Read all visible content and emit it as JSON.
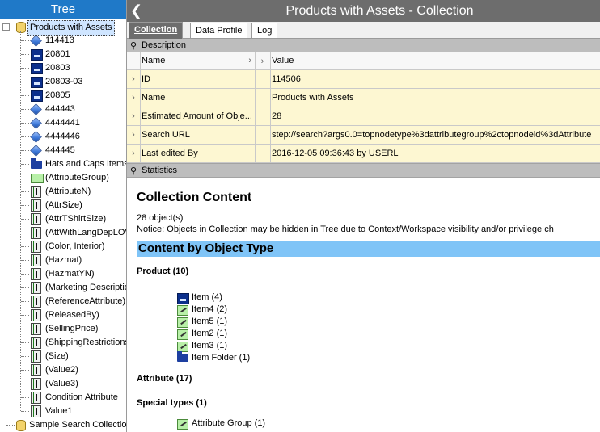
{
  "tree": {
    "header": "Tree",
    "root_label": "Products with Assets",
    "items": [
      {
        "label": "114413",
        "icon": "cube-icon"
      },
      {
        "label": "20801",
        "icon": "item-icon"
      },
      {
        "label": "20803",
        "icon": "item-icon"
      },
      {
        "label": "20803-03",
        "icon": "item-icon"
      },
      {
        "label": "20805",
        "icon": "item-icon"
      },
      {
        "label": "444443",
        "icon": "cube-icon"
      },
      {
        "label": "4444441",
        "icon": "cube-icon"
      },
      {
        "label": "4444446",
        "icon": "cube-icon"
      },
      {
        "label": "444445",
        "icon": "cube-icon"
      },
      {
        "label": "Hats and Caps Items",
        "icon": "folder-icon"
      },
      {
        "label": "(AttributeGroup)",
        "icon": "attribute-group-icon"
      },
      {
        "label": "(AttributeN)",
        "icon": "attribute-icon"
      },
      {
        "label": "(AttrSize)",
        "icon": "attribute-icon"
      },
      {
        "label": "(AttrTShirtSize)",
        "icon": "attribute-icon"
      },
      {
        "label": "(AttWithLangDepLOV",
        "icon": "attribute-icon"
      },
      {
        "label": "(Color, Interior)",
        "icon": "attribute-icon"
      },
      {
        "label": "(Hazmat)",
        "icon": "attribute-icon"
      },
      {
        "label": "(HazmatYN)",
        "icon": "attribute-icon"
      },
      {
        "label": "(Marketing Descriptio",
        "icon": "attribute-icon"
      },
      {
        "label": "(ReferenceAttribute)",
        "icon": "attribute-icon"
      },
      {
        "label": "(ReleasedBy)",
        "icon": "attribute-icon"
      },
      {
        "label": "(SellingPrice)",
        "icon": "attribute-icon"
      },
      {
        "label": "(ShippingRestrictions",
        "icon": "attribute-icon"
      },
      {
        "label": "(Size)",
        "icon": "attribute-icon"
      },
      {
        "label": "(Value2)",
        "icon": "attribute-icon"
      },
      {
        "label": "(Value3)",
        "icon": "attribute-icon"
      },
      {
        "label": "Condition Attribute",
        "icon": "attribute-icon"
      },
      {
        "label": "Value1",
        "icon": "attribute-icon"
      }
    ],
    "sibling_label": "Sample Search Collection"
  },
  "main": {
    "title": "Products with Assets - Collection",
    "tabs": [
      {
        "label": "Collection",
        "active": true
      },
      {
        "label": "Data Profile",
        "active": false
      },
      {
        "label": "Log",
        "active": false
      }
    ],
    "description": {
      "section_label": "Description",
      "col_name": "Name",
      "col_value": "Value",
      "rows": [
        {
          "name": "ID",
          "value": "114506"
        },
        {
          "name": "Name",
          "value": "Products with Assets"
        },
        {
          "name": "Estimated Amount of Obje...",
          "value": "28"
        },
        {
          "name": "Search URL",
          "value": "step://search?args0.0=topnodetype%3dattributegroup%2ctopnodeid%3dAttribute"
        },
        {
          "name": "Last edited By",
          "value": "2016-12-05 09:36:43 by USERL"
        }
      ]
    },
    "statistics": {
      "section_label": "Statistics",
      "heading": "Collection Content",
      "count_line": "28 object(s)",
      "notice": "Notice: Objects in Collection may be hidden in Tree due to Context/Workspace visibility and/or privilege ch",
      "by_type_heading": "Content by Object Type",
      "groups": [
        {
          "label": "Product (10)",
          "entries": [
            {
              "label": "Item (4)",
              "icon": "item-icon"
            },
            {
              "label": "Item4 (2)",
              "icon": "edit-type-icon"
            },
            {
              "label": "Item5 (1)",
              "icon": "edit-type-icon"
            },
            {
              "label": "Item2 (1)",
              "icon": "edit-type-icon"
            },
            {
              "label": "Item3 (1)",
              "icon": "edit-type-icon"
            },
            {
              "label": "Item Folder (1)",
              "icon": "folder-icon"
            }
          ]
        },
        {
          "label": "Attribute (17)",
          "entries": []
        },
        {
          "label": "Special types (1)",
          "entries": [
            {
              "label": "Attribute Group (1)",
              "icon": "edit-type-icon"
            }
          ]
        }
      ]
    }
  }
}
